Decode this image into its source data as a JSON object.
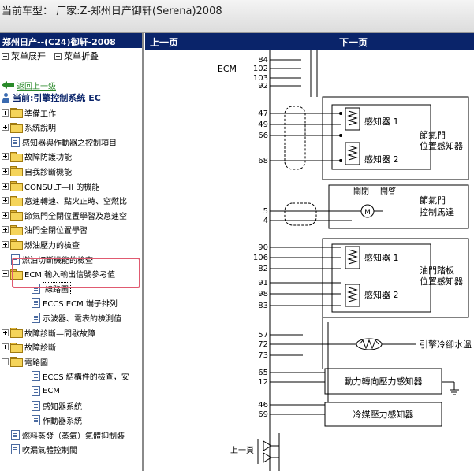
{
  "window": {
    "title": "当前车型： 厂家:Z-郑州日产御轩(Serena)2008"
  },
  "sidebar": {
    "header": "郑州日产--(C24)御轩-2008",
    "expand_all": "菜单展开",
    "collapse_all": "菜单折叠",
    "back_link": "返回上一级",
    "current": "当前:引擎控制系统 EC",
    "items": [
      {
        "label": "準備工作",
        "type": "folder",
        "expander": "plus"
      },
      {
        "label": "系統說明",
        "type": "folder",
        "expander": "plus"
      },
      {
        "label": "感知器與作動器之控制項目",
        "type": "doc",
        "expander": "none"
      },
      {
        "label": "故障防護功能",
        "type": "folder",
        "expander": "plus"
      },
      {
        "label": "自我診斷機能",
        "type": "folder",
        "expander": "plus"
      },
      {
        "label": "CONSULT—II 的機能",
        "type": "folder",
        "expander": "plus"
      },
      {
        "label": "怠速轉速、點火正時、空燃比",
        "type": "folder",
        "expander": "plus"
      },
      {
        "label": "節氣門全閉位置學習及怠速空",
        "type": "folder",
        "expander": "plus"
      },
      {
        "label": "油門全閉位置學習",
        "type": "folder",
        "expander": "plus"
      },
      {
        "label": "燃油壓力的檢查",
        "type": "folder",
        "expander": "plus"
      },
      {
        "label": "燃油切斷機能的檢查",
        "type": "doc",
        "expander": "none"
      },
      {
        "label": "ECM 輸入輸出信號參考值",
        "type": "folder",
        "expander": "minus"
      },
      {
        "label": "線路圖",
        "type": "doc",
        "expander": "none",
        "selected": true
      },
      {
        "label": "ECCS ECM 端子排列",
        "type": "doc",
        "expander": "none"
      },
      {
        "label": "示波器、電表的檢測值",
        "type": "doc",
        "expander": "none"
      },
      {
        "label": "故障診斷—間歇故障",
        "type": "folder",
        "expander": "plus"
      },
      {
        "label": "故障診斷",
        "type": "folder",
        "expander": "plus"
      },
      {
        "label": "電路圖",
        "type": "folder",
        "expander": "minus"
      },
      {
        "label": "ECCS 結構件的檢查，安",
        "type": "doc",
        "expander": "none"
      },
      {
        "label": "ECM",
        "type": "doc",
        "expander": "none"
      },
      {
        "label": "感知器系統",
        "type": "doc",
        "expander": "none"
      },
      {
        "label": "作動器系統",
        "type": "doc",
        "expander": "none"
      },
      {
        "label": "燃料蒸發（蒸氣）氣體抑制裝",
        "type": "doc",
        "expander": "none"
      },
      {
        "label": "吹漏氣體控制閥",
        "type": "doc",
        "expander": "none"
      }
    ]
  },
  "nav": {
    "prev": "上一页",
    "next": "下一页"
  },
  "diagram": {
    "ecm_label": "ECM",
    "pins_top": [
      "84",
      "102",
      "103",
      "92"
    ],
    "pins_tps": [
      "47",
      "49",
      "66",
      "68"
    ],
    "pins_motor": [
      "5",
      "4"
    ],
    "pins_app": [
      "90",
      "106",
      "82",
      "91",
      "98",
      "83"
    ],
    "pins_ect": [
      "57",
      "72",
      "73"
    ],
    "pins_ps": [
      "65",
      "12"
    ],
    "pins_ac": [
      "46",
      "69"
    ],
    "sensor1": "感知器 1",
    "sensor2": "感知器 2",
    "tps_label_1": "節氣門",
    "tps_label_2": "位置感知器",
    "close": "關閉",
    "open": "開啓",
    "motor_label_1": "節氣門",
    "motor_label_2": "控制馬達",
    "app_label_1": "油門踏板",
    "app_label_2": "位置感知器",
    "ect_label": "引擎冷卻水溫",
    "ps_label": "動力轉向壓力感知器",
    "ac_label": "冷媒壓力感知器",
    "prev_page": "上一頁"
  }
}
